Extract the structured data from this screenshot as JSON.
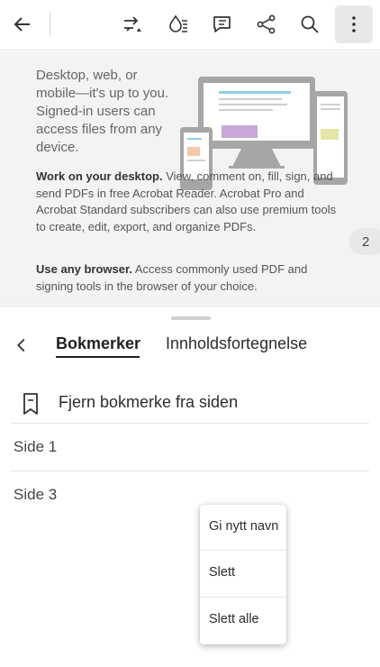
{
  "toolbar": {
    "icons": [
      "back-arrow-icon",
      "reflow-icon",
      "fill-sign-icon",
      "comment-icon",
      "share-icon",
      "search-icon",
      "more-vertical-icon"
    ]
  },
  "document": {
    "intro": "Desktop, web, or mobile—it's up to you. Signed-in users can access files from any device.",
    "desktop_heading": "Work on your desktop.",
    "desktop_body": " View, comment on, fill, sign, and send PDFs in free Acrobat Reader. Acrobat Pro and Acrobat Standard subscribers can also use premium tools to create, edit, export, and organize PDFs.",
    "browser_heading": "Use any browser.",
    "browser_body": " Access commonly used PDF and signing tools in the browser of your choice.",
    "page_number": "2"
  },
  "panel": {
    "tabs": [
      {
        "label": "Bokmerker",
        "active": true
      },
      {
        "label": "Innholdsfortegnelse",
        "active": false
      }
    ],
    "remove_bookmark_label": "Fjern bokmerke fra siden",
    "bookmarks": [
      {
        "label": "Side 1"
      },
      {
        "label": "Side 3"
      }
    ]
  },
  "context_menu": {
    "items": [
      {
        "label": "Gi nytt navn"
      },
      {
        "label": "Slett"
      },
      {
        "label": "Slett alle"
      }
    ]
  },
  "colors": {
    "accent_purple": "#c8a8d8",
    "accent_yellow": "#e4e6a8",
    "accent_blue": "#8fd0e4",
    "device_gray": "#a6a6a6"
  }
}
